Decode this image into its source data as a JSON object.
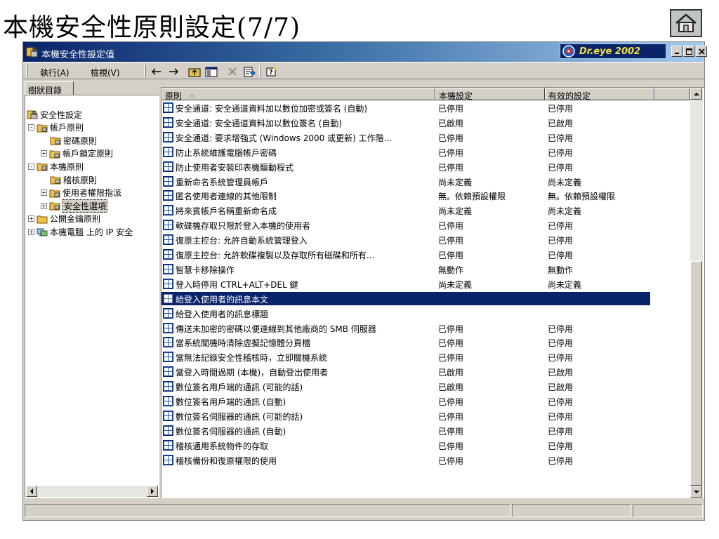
{
  "slide": {
    "title": "本機安全性原則設定(7/7)",
    "home_icon": "home-icon"
  },
  "window": {
    "title": "本機安全性設定值",
    "dreye_label": "Dr.eye 2002",
    "buttons": {
      "minimize": "minimize-icon",
      "maximize": "maximize-icon",
      "close": "close-icon"
    }
  },
  "menu": {
    "action": "執行(A)",
    "view": "檢視(V)"
  },
  "toolbar": {
    "icons": [
      "back-arrow-icon",
      "forward-arrow-icon",
      "up-folder-icon",
      "show-hide-tree-icon",
      "delete-icon",
      "export-list-icon",
      "help-icon"
    ]
  },
  "tree": {
    "tab_label": "樹狀目錄",
    "items": [
      {
        "label": "安全性設定",
        "level": 0,
        "expander": ""
      },
      {
        "label": "帳戶原則",
        "level": 1,
        "expander": "-"
      },
      {
        "label": "密碼原則",
        "level": 2,
        "expander": ""
      },
      {
        "label": "帳戶鎖定原則",
        "level": 2,
        "expander": "+"
      },
      {
        "label": "本機原則",
        "level": 1,
        "expander": "-"
      },
      {
        "label": "稽核原則",
        "level": 2,
        "expander": ""
      },
      {
        "label": "使用者權限指派",
        "level": 2,
        "expander": "+"
      },
      {
        "label": "安全性選項",
        "level": 2,
        "expander": "+",
        "selected": true
      },
      {
        "label": "公開金鑰原則",
        "level": 1,
        "expander": "+"
      },
      {
        "label": "本機電腦 上的 IP 安全",
        "level": 1,
        "expander": "+"
      }
    ]
  },
  "list": {
    "columns": [
      "原則",
      "本機設定",
      "有效的設定"
    ],
    "sort_indicator": "△",
    "rows": [
      {
        "policy": "安全通道: 安全通道資料加以數位加密或簽名 (自動)",
        "local": "已停用",
        "effective": "已停用"
      },
      {
        "policy": "安全通道: 安全通道資料加以數位簽名 (自動)",
        "local": "已啟用",
        "effective": "已啟用"
      },
      {
        "policy": "安全通道: 要求增強式 (Windows 2000 或更新) 工作階...",
        "local": "已停用",
        "effective": "已停用"
      },
      {
        "policy": "防止系統維護電腦帳戶密碼",
        "local": "已停用",
        "effective": "已停用"
      },
      {
        "policy": "防止使用者安裝印表機驅動程式",
        "local": "已停用",
        "effective": "已停用"
      },
      {
        "policy": "重新命名系統管理員帳戶",
        "local": "尚未定義",
        "effective": "尚未定義"
      },
      {
        "policy": "匿名使用者連線的其他限制",
        "local": "無。依賴預設權限",
        "effective": "無。依賴預設權限"
      },
      {
        "policy": "將來賓帳戶名稱重新命名成",
        "local": "尚未定義",
        "effective": "尚未定義"
      },
      {
        "policy": "軟碟機存取只限於登入本機的使用者",
        "local": "已停用",
        "effective": "已停用"
      },
      {
        "policy": "復原主控台: 允許自動系統管理登入",
        "local": "已停用",
        "effective": "已停用"
      },
      {
        "policy": "復原主控台: 允許軟碟複製以及存取所有磁碟和所有...",
        "local": "已停用",
        "effective": "已停用"
      },
      {
        "policy": "智慧卡移除操作",
        "local": "無動作",
        "effective": "無動作"
      },
      {
        "policy": "登入時停用 CTRL+ALT+DEL 鍵",
        "local": "尚未定義",
        "effective": "尚未定義"
      },
      {
        "policy": "給登入使用者的訊息本文",
        "local": "",
        "effective": "",
        "selected": true
      },
      {
        "policy": "給登入使用者的訊息標題",
        "local": "",
        "effective": ""
      },
      {
        "policy": "傳送未加密的密碼以便連線到其他廠商的 SMB 伺服器",
        "local": "已停用",
        "effective": "已停用"
      },
      {
        "policy": "當系統關機時清除虛擬記憶體分頁檔",
        "local": "已停用",
        "effective": "已停用"
      },
      {
        "policy": "當無法記錄安全性稽核時，立即關機系統",
        "local": "已停用",
        "effective": "已停用"
      },
      {
        "policy": "當登入時間過期 (本機)，自動登出使用者",
        "local": "已啟用",
        "effective": "已啟用"
      },
      {
        "policy": "數位簽名用戶端的通訊 (可能的話)",
        "local": "已啟用",
        "effective": "已啟用"
      },
      {
        "policy": "數位簽名用戶端的通訊 (自動)",
        "local": "已停用",
        "effective": "已停用"
      },
      {
        "policy": "數位簽名伺服器的通訊 (可能的話)",
        "local": "已停用",
        "effective": "已停用"
      },
      {
        "policy": "數位簽名伺服器的通訊 (自動)",
        "local": "已停用",
        "effective": "已停用"
      },
      {
        "policy": "稽核通用系統物件的存取",
        "local": "已停用",
        "effective": "已停用"
      },
      {
        "policy": "稽核備份和復原權限的使用",
        "local": "已停用",
        "effective": "已停用"
      }
    ]
  },
  "colors": {
    "title_bar_start": "#0a246a",
    "title_bar_end": "#a6caf0",
    "window_face": "#d4d0c8",
    "selection": "#0a246a",
    "folder": "#e8c24a",
    "dreye_text": "#f0e040"
  }
}
